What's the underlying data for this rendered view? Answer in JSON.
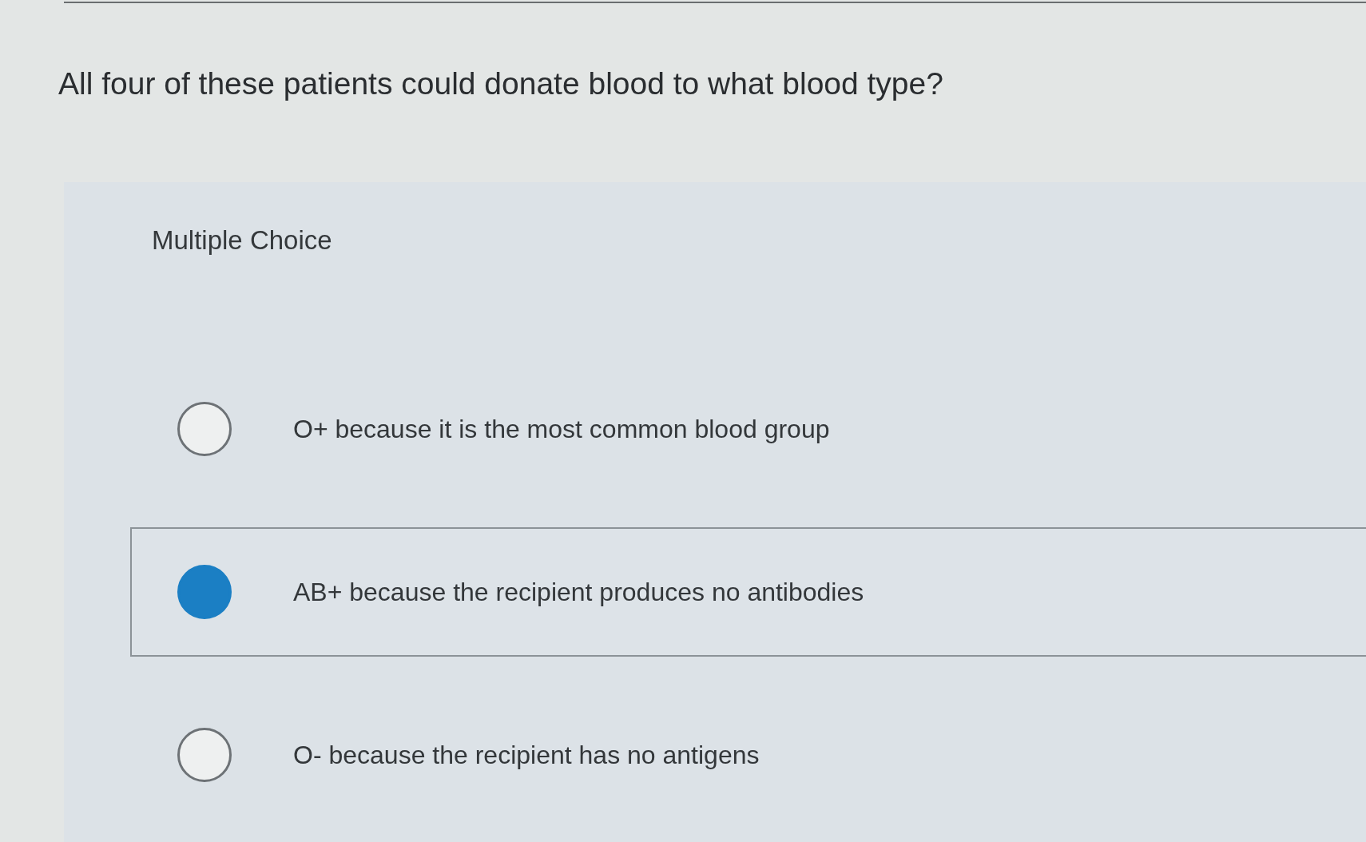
{
  "question": "All four of these patients could donate blood to what blood type?",
  "answer_panel": {
    "label": "Multiple Choice",
    "options": [
      {
        "text": "O+ because it is the most common blood group",
        "selected": false
      },
      {
        "text": "AB+ because the recipient produces no antibodies",
        "selected": true
      },
      {
        "text": "O- because the recipient has no antigens",
        "selected": false
      }
    ]
  }
}
